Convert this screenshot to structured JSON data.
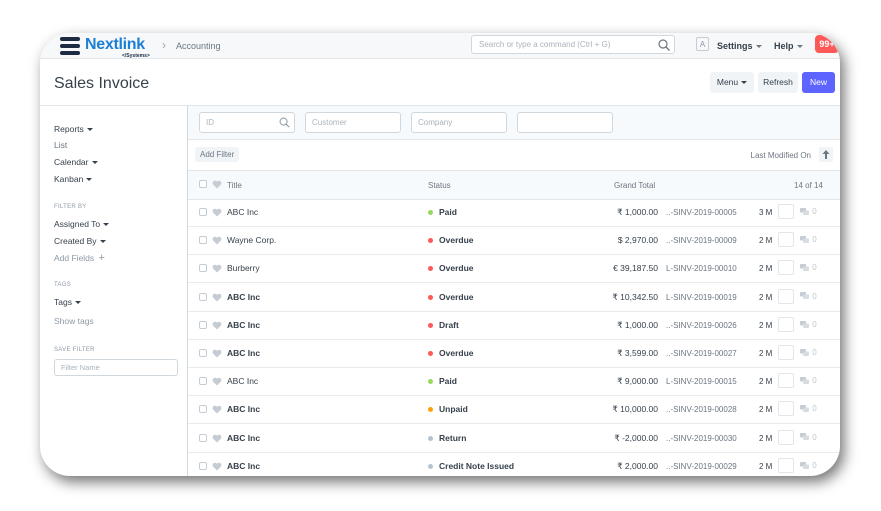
{
  "navbar": {
    "brand": "Nextlink",
    "brand_sub": "</Systems>",
    "breadcrumb": "Accounting",
    "search_placeholder": "Search or type a command (Ctrl + G)",
    "avatar_letter": "A",
    "settings_label": "Settings",
    "help_label": "Help",
    "notification_count": "99+"
  },
  "page": {
    "title": "Sales Invoice",
    "menu_label": "Menu",
    "refresh_label": "Refresh",
    "new_label": "New"
  },
  "sidebar": {
    "reports": "Reports",
    "list": "List",
    "calendar": "Calendar",
    "kanban": "Kanban",
    "filter_by_label": "FILTER BY",
    "assigned_to": "Assigned To",
    "created_by": "Created By",
    "add_fields": "Add Fields",
    "tags_label": "TAGS",
    "tags": "Tags",
    "show_tags": "Show tags",
    "save_filter_label": "SAVE FILTER",
    "filter_name_placeholder": "Filter Name"
  },
  "filters": {
    "id_placeholder": "ID",
    "customer_placeholder": "Customer",
    "company_placeholder": "Company",
    "add_filter": "Add Filter",
    "sort_label": "Last Modified On"
  },
  "table": {
    "col_title": "Title",
    "col_status": "Status",
    "col_total": "Grand Total",
    "count": "14 of 14",
    "rows": [
      {
        "title": "ABC Inc",
        "bold": false,
        "status": "Paid",
        "status_color": "#98d85b",
        "amount": "₹ 1,000.00",
        "name": "..-SINV-2019-00005",
        "time": "3 M",
        "comments": "0"
      },
      {
        "title": "Wayne Corp.",
        "bold": false,
        "status": "Overdue",
        "status_color": "#ff5858",
        "amount": "$ 2,970.00",
        "name": "..-SINV-2019-00009",
        "time": "2 M",
        "comments": "0"
      },
      {
        "title": "Burberry",
        "bold": false,
        "status": "Overdue",
        "status_color": "#ff5858",
        "amount": "€ 39,187.50",
        "name": "L-SINV-2019-00010",
        "time": "2 M",
        "comments": "0"
      },
      {
        "title": "ABC Inc",
        "bold": true,
        "status": "Overdue",
        "status_color": "#ff5858",
        "amount": "₹ 10,342.50",
        "name": "L-SINV-2019-00019",
        "time": "2 M",
        "comments": "0"
      },
      {
        "title": "ABC Inc",
        "bold": true,
        "status": "Draft",
        "status_color": "#ff5858",
        "amount": "₹ 1,000.00",
        "name": "..-SINV-2019-00026",
        "time": "2 M",
        "comments": "0"
      },
      {
        "title": "ABC Inc",
        "bold": true,
        "status": "Overdue",
        "status_color": "#ff5858",
        "amount": "₹ 3,599.00",
        "name": "..-SINV-2019-00027",
        "time": "2 M",
        "comments": "0"
      },
      {
        "title": "ABC Inc",
        "bold": false,
        "status": "Paid",
        "status_color": "#98d85b",
        "amount": "₹ 9,000.00",
        "name": "L-SINV-2019-00015",
        "time": "2 M",
        "comments": "0"
      },
      {
        "title": "ABC Inc",
        "bold": true,
        "status": "Unpaid",
        "status_color": "#ffa00a",
        "amount": "₹ 10,000.00",
        "name": "..-SINV-2019-00028",
        "time": "2 M",
        "comments": "0"
      },
      {
        "title": "ABC Inc",
        "bold": true,
        "status": "Return",
        "status_color": "#b8c2cc",
        "amount": "₹ -2,000.00",
        "name": "..-SINV-2019-00030",
        "time": "2 M",
        "comments": "0"
      },
      {
        "title": "ABC Inc",
        "bold": true,
        "status": "Credit Note Issued",
        "status_color": "#b8c2cc",
        "amount": "₹ 2,000.00",
        "name": "..-SINV-2019-00029",
        "time": "2 M",
        "comments": "0"
      }
    ]
  }
}
